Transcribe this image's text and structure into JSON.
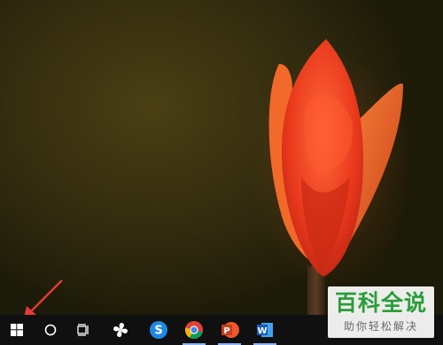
{
  "wallpaper": {
    "subject": "red tulip",
    "icon": "tulip-wallpaper"
  },
  "taskbar": {
    "items": [
      {
        "name": "start-button",
        "icon": "windows-logo-icon"
      },
      {
        "name": "search-button",
        "icon": "cortana-circle-icon"
      },
      {
        "name": "task-view-button",
        "icon": "task-view-icon"
      },
      {
        "name": "pinwheel-app",
        "icon": "pinwheel-icon"
      },
      {
        "name": "sogou-browser",
        "icon": "sogou-s-icon"
      },
      {
        "name": "chrome-browser",
        "icon": "chrome-icon"
      },
      {
        "name": "powerpoint-app",
        "icon": "powerpoint-icon"
      },
      {
        "name": "word-app",
        "icon": "word-icon"
      }
    ],
    "colors": {
      "background": "#101010",
      "active_indicator": "#8ab4f8"
    }
  },
  "annotation": {
    "icon": "red-arrow-pointer",
    "color": "#e53935"
  },
  "watermark": {
    "title": "百科全说",
    "subtitle": "助你轻松解决",
    "colors": {
      "title": "#2a9d3a",
      "subtitle": "#6b6b6b"
    }
  },
  "icons": {
    "word_letter": "W",
    "powerpoint_letter": "P",
    "sogou_letter": "S"
  }
}
